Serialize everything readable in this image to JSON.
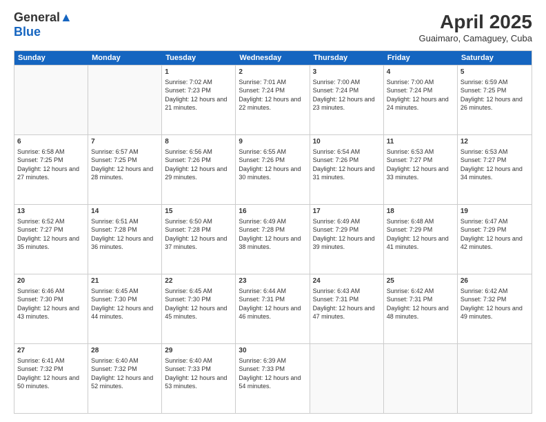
{
  "header": {
    "logo_line1": "General",
    "logo_line2": "Blue",
    "month": "April 2025",
    "location": "Guaimaro, Camaguey, Cuba"
  },
  "weekdays": [
    "Sunday",
    "Monday",
    "Tuesday",
    "Wednesday",
    "Thursday",
    "Friday",
    "Saturday"
  ],
  "rows": [
    [
      {
        "day": "",
        "info": ""
      },
      {
        "day": "",
        "info": ""
      },
      {
        "day": "1",
        "info": "Sunrise: 7:02 AM\nSunset: 7:23 PM\nDaylight: 12 hours and 21 minutes."
      },
      {
        "day": "2",
        "info": "Sunrise: 7:01 AM\nSunset: 7:24 PM\nDaylight: 12 hours and 22 minutes."
      },
      {
        "day": "3",
        "info": "Sunrise: 7:00 AM\nSunset: 7:24 PM\nDaylight: 12 hours and 23 minutes."
      },
      {
        "day": "4",
        "info": "Sunrise: 7:00 AM\nSunset: 7:24 PM\nDaylight: 12 hours and 24 minutes."
      },
      {
        "day": "5",
        "info": "Sunrise: 6:59 AM\nSunset: 7:25 PM\nDaylight: 12 hours and 26 minutes."
      }
    ],
    [
      {
        "day": "6",
        "info": "Sunrise: 6:58 AM\nSunset: 7:25 PM\nDaylight: 12 hours and 27 minutes."
      },
      {
        "day": "7",
        "info": "Sunrise: 6:57 AM\nSunset: 7:25 PM\nDaylight: 12 hours and 28 minutes."
      },
      {
        "day": "8",
        "info": "Sunrise: 6:56 AM\nSunset: 7:26 PM\nDaylight: 12 hours and 29 minutes."
      },
      {
        "day": "9",
        "info": "Sunrise: 6:55 AM\nSunset: 7:26 PM\nDaylight: 12 hours and 30 minutes."
      },
      {
        "day": "10",
        "info": "Sunrise: 6:54 AM\nSunset: 7:26 PM\nDaylight: 12 hours and 31 minutes."
      },
      {
        "day": "11",
        "info": "Sunrise: 6:53 AM\nSunset: 7:27 PM\nDaylight: 12 hours and 33 minutes."
      },
      {
        "day": "12",
        "info": "Sunrise: 6:53 AM\nSunset: 7:27 PM\nDaylight: 12 hours and 34 minutes."
      }
    ],
    [
      {
        "day": "13",
        "info": "Sunrise: 6:52 AM\nSunset: 7:27 PM\nDaylight: 12 hours and 35 minutes."
      },
      {
        "day": "14",
        "info": "Sunrise: 6:51 AM\nSunset: 7:28 PM\nDaylight: 12 hours and 36 minutes."
      },
      {
        "day": "15",
        "info": "Sunrise: 6:50 AM\nSunset: 7:28 PM\nDaylight: 12 hours and 37 minutes."
      },
      {
        "day": "16",
        "info": "Sunrise: 6:49 AM\nSunset: 7:28 PM\nDaylight: 12 hours and 38 minutes."
      },
      {
        "day": "17",
        "info": "Sunrise: 6:49 AM\nSunset: 7:29 PM\nDaylight: 12 hours and 39 minutes."
      },
      {
        "day": "18",
        "info": "Sunrise: 6:48 AM\nSunset: 7:29 PM\nDaylight: 12 hours and 41 minutes."
      },
      {
        "day": "19",
        "info": "Sunrise: 6:47 AM\nSunset: 7:29 PM\nDaylight: 12 hours and 42 minutes."
      }
    ],
    [
      {
        "day": "20",
        "info": "Sunrise: 6:46 AM\nSunset: 7:30 PM\nDaylight: 12 hours and 43 minutes."
      },
      {
        "day": "21",
        "info": "Sunrise: 6:45 AM\nSunset: 7:30 PM\nDaylight: 12 hours and 44 minutes."
      },
      {
        "day": "22",
        "info": "Sunrise: 6:45 AM\nSunset: 7:30 PM\nDaylight: 12 hours and 45 minutes."
      },
      {
        "day": "23",
        "info": "Sunrise: 6:44 AM\nSunset: 7:31 PM\nDaylight: 12 hours and 46 minutes."
      },
      {
        "day": "24",
        "info": "Sunrise: 6:43 AM\nSunset: 7:31 PM\nDaylight: 12 hours and 47 minutes."
      },
      {
        "day": "25",
        "info": "Sunrise: 6:42 AM\nSunset: 7:31 PM\nDaylight: 12 hours and 48 minutes."
      },
      {
        "day": "26",
        "info": "Sunrise: 6:42 AM\nSunset: 7:32 PM\nDaylight: 12 hours and 49 minutes."
      }
    ],
    [
      {
        "day": "27",
        "info": "Sunrise: 6:41 AM\nSunset: 7:32 PM\nDaylight: 12 hours and 50 minutes."
      },
      {
        "day": "28",
        "info": "Sunrise: 6:40 AM\nSunset: 7:32 PM\nDaylight: 12 hours and 52 minutes."
      },
      {
        "day": "29",
        "info": "Sunrise: 6:40 AM\nSunset: 7:33 PM\nDaylight: 12 hours and 53 minutes."
      },
      {
        "day": "30",
        "info": "Sunrise: 6:39 AM\nSunset: 7:33 PM\nDaylight: 12 hours and 54 minutes."
      },
      {
        "day": "",
        "info": ""
      },
      {
        "day": "",
        "info": ""
      },
      {
        "day": "",
        "info": ""
      }
    ]
  ]
}
